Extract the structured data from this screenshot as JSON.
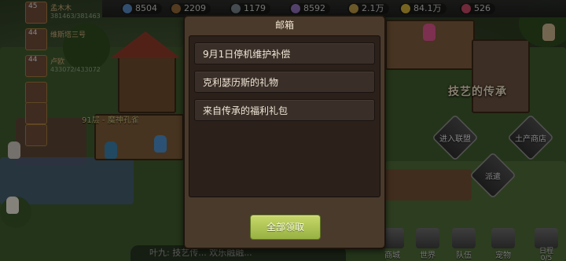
{
  "resources": [
    {
      "icon": "gem-icon",
      "value": "8504",
      "color": "#5b8fd0"
    },
    {
      "icon": "wood-icon",
      "value": "2209",
      "color": "#9a6b3a"
    },
    {
      "icon": "ore-icon",
      "value": "1179",
      "color": "#7f8a95"
    },
    {
      "icon": "crystal-icon",
      "value": "8592",
      "color": "#9b77c8"
    },
    {
      "icon": "food-icon",
      "value": "2.1万",
      "color": "#c7a24a"
    },
    {
      "icon": "gold-coin-icon",
      "value": "84.1万",
      "color": "#e0b83a"
    },
    {
      "icon": "diamond-icon",
      "value": "526",
      "color": "#d04a6a"
    }
  ],
  "party": [
    {
      "level": "45",
      "name": "孟木木",
      "hp": "381463/381463"
    },
    {
      "level": "44",
      "name": "维斯塔三号",
      "hp": ""
    },
    {
      "level": "44",
      "name": "卢欧",
      "hp": "433072/433072"
    }
  ],
  "scene": {
    "floor_label": "91层 - 魔神孔雀",
    "legacy_banner": "技艺的传承",
    "chat_preview": "叶九: 技艺传... 欢乐融融..."
  },
  "side_menu": {
    "join_alliance": "进入联盟",
    "local_shop": "土产商店",
    "dispatch": "派遣"
  },
  "bottom_menu": [
    {
      "label": "商城",
      "icon": "cart-icon"
    },
    {
      "label": "世界",
      "icon": "map-icon"
    },
    {
      "label": "队伍",
      "icon": "team-icon"
    },
    {
      "label": "宠物",
      "icon": "pet-icon"
    },
    {
      "label": "日程",
      "icon": "schedule-icon",
      "badge": "0/5"
    }
  ],
  "mailbox": {
    "title": "邮箱",
    "mails": [
      "9月1日停机维护补偿",
      "克利瑟历斯的礼物",
      "来自传承的福利礼包"
    ],
    "claim_all": "全部领取"
  }
}
